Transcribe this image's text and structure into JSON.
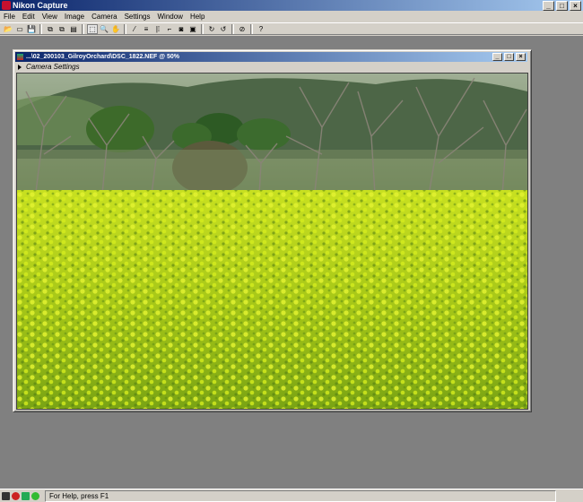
{
  "app": {
    "title": "Nikon Capture",
    "icon": "nikon-capture-icon"
  },
  "window_buttons": [
    "_",
    "□",
    "×"
  ],
  "menu": [
    "File",
    "Edit",
    "View",
    "Image",
    "Camera",
    "Settings",
    "Window",
    "Help"
  ],
  "toolbar": {
    "groups": [
      [
        {
          "name": "open-icon",
          "glyph": "📂"
        },
        {
          "name": "browser-icon",
          "glyph": "▭"
        },
        {
          "name": "save-icon",
          "glyph": "💾"
        }
      ],
      [
        {
          "name": "copy-icon",
          "glyph": "⧉"
        },
        {
          "name": "paste-icon",
          "glyph": "⧉"
        },
        {
          "name": "paste-special-icon",
          "glyph": "▤"
        }
      ],
      [
        {
          "name": "select-tool-icon",
          "glyph": "⬚"
        },
        {
          "name": "zoom-tool-icon",
          "glyph": "🔍"
        },
        {
          "name": "hand-tool-icon",
          "glyph": "✋"
        }
      ],
      [
        {
          "name": "gray-point-icon",
          "glyph": "⁄"
        },
        {
          "name": "color-balance-icon",
          "glyph": "≡"
        },
        {
          "name": "straighten-icon",
          "glyph": "|⁞"
        },
        {
          "name": "crop-icon",
          "glyph": "⌐"
        },
        {
          "name": "camera-icon",
          "glyph": "◙"
        },
        {
          "name": "image-info-icon",
          "glyph": "▣"
        }
      ],
      [
        {
          "name": "rotate-right-icon",
          "glyph": "↻"
        },
        {
          "name": "rotate-left-icon",
          "glyph": "↺"
        }
      ],
      [
        {
          "name": "stop-icon",
          "glyph": "⊘"
        }
      ],
      [
        {
          "name": "context-help-icon",
          "glyph": "?"
        }
      ]
    ]
  },
  "document": {
    "title": "...\\02_200103_GilroyOrchard\\DSC_1822.NEF @ 50%",
    "settings_label": "Camera Settings"
  },
  "status": {
    "text": "For Help, press F1"
  },
  "colors": {
    "titlebar_start": "#0a246a",
    "titlebar_end": "#a6caf0",
    "workspace": "#808080",
    "chrome": "#d4d0c8"
  }
}
